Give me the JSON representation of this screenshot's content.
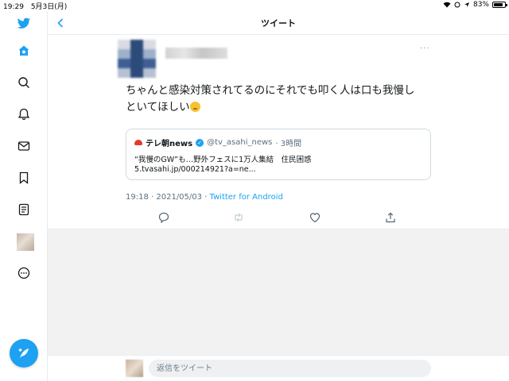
{
  "status_bar": {
    "time": "19:29",
    "date": "5月3日(月)",
    "battery": "83%",
    "battery_level": 0.83
  },
  "header": {
    "title": "ツイート"
  },
  "sidebar": {
    "items": [
      {
        "icon": "twitter-logo-icon"
      },
      {
        "icon": "home-icon"
      },
      {
        "icon": "search-icon"
      },
      {
        "icon": "bell-icon"
      },
      {
        "icon": "mail-icon"
      },
      {
        "icon": "bookmark-icon"
      },
      {
        "icon": "list-icon"
      },
      {
        "icon": "profile-avatar"
      },
      {
        "icon": "more-icon"
      }
    ],
    "compose_icon": "compose-icon"
  },
  "tweet": {
    "more": "···",
    "text_line1": "ちゃんと感染対策されてるのにそれでも叩く人は口も我慢し",
    "text_line2": "といてほしい",
    "quote": {
      "name": "テレ朝news",
      "handle": "@tv_asahi_news",
      "time": "· 3時間",
      "line1": "“我慢のGW”も…野外フェスに1万人集結　住民困惑",
      "line2": "5.tvasahi.jp/000214921?a=ne..."
    },
    "timestamp": "19:18 · 2021/05/03 · ",
    "source": "Twitter for Android"
  },
  "reply": {
    "placeholder": "返信をツイート"
  },
  "colors": {
    "accent": "#1da1f2",
    "border": "#e6ecf0",
    "muted": "#5b7083"
  }
}
